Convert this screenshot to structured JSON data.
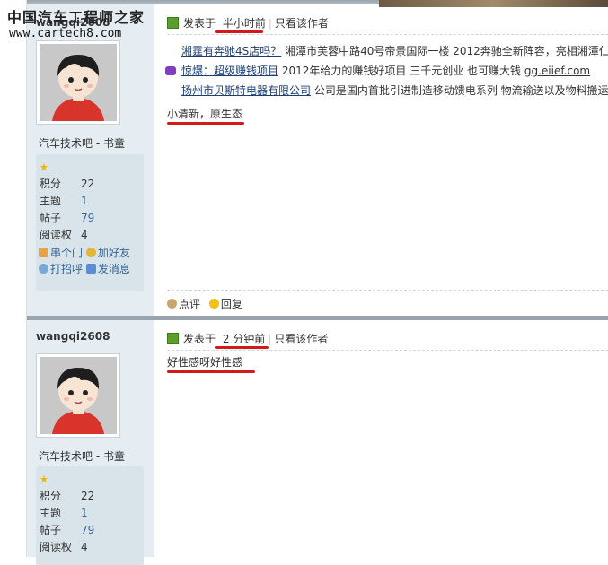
{
  "watermark": {
    "title": "中国汽车工程师之家",
    "url": "www.cartech8.com"
  },
  "posts": [
    {
      "username": "wangqi2608",
      "rank": "汽车技术吧 - 书童",
      "stats": [
        {
          "label": "积分",
          "value": "22"
        },
        {
          "label": "主题",
          "value": "1"
        },
        {
          "label": "帖子",
          "value": "79"
        },
        {
          "label": "阅读权",
          "value": "4"
        }
      ],
      "actions": {
        "tm": "串个门",
        "add_friend": "加好友",
        "greet": "打招呼",
        "message": "发消息"
      },
      "meta": {
        "posted_prefix": "发表于",
        "time": "半小时前",
        "only_author": "只看该作者"
      },
      "ads": [
        {
          "title": "湘霆有奔驰4S店吗？",
          "text": "湘潭市芙蓉中路40号帝景国际一楼 2012奔驰全新阵容，亮相湘潭仁"
        },
        {
          "title": "惊爆：超级赚钱项目",
          "text": "2012年给力的赚钱好项目 三千元创业 也可赚大钱",
          "link": "gg.eiief.com"
        },
        {
          "title": "扬州市贝斯特电器有限公司",
          "text": "公司是国内首批引进制造移动馈电系列 物流输送以及物料搬运"
        }
      ],
      "content": "小清新，原生态",
      "footer": {
        "comment": "点评",
        "reply": "回复"
      }
    },
    {
      "username": "wangqi2608",
      "rank": "汽车技术吧 - 书童",
      "stats": [
        {
          "label": "积分",
          "value": "22"
        },
        {
          "label": "主题",
          "value": "1"
        },
        {
          "label": "帖子",
          "value": "79"
        },
        {
          "label": "阅读权",
          "value": "4"
        }
      ],
      "meta": {
        "posted_prefix": "发表于",
        "time": "2 分钟前",
        "only_author": "只看该作者"
      },
      "content": "好性感呀好性感"
    }
  ]
}
